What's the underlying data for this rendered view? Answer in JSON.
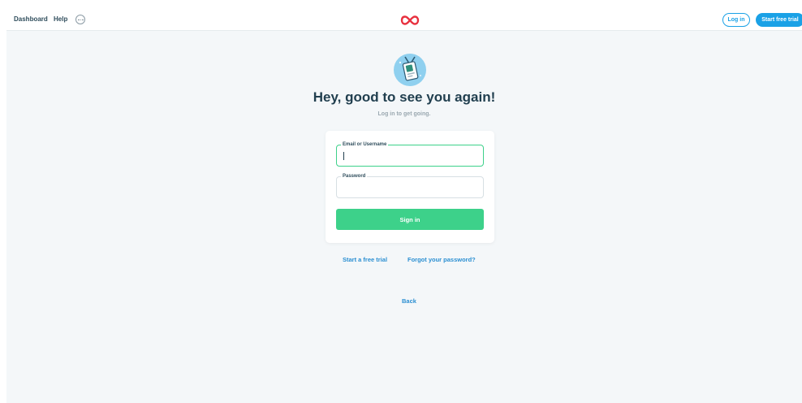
{
  "topbar": {
    "nav": [
      {
        "label": "Dashboard"
      },
      {
        "label": "Help"
      }
    ],
    "login_label": "Log in",
    "trial_label": "Start free trial"
  },
  "hero": {
    "title": "Hey, good to see you again!",
    "subtitle": "Log in to get going."
  },
  "form": {
    "email_label": "Email or Username",
    "email_value": "",
    "password_label": "Password",
    "password_value": "",
    "submit_label": "Sign in"
  },
  "links": {
    "trial": "Start a free trial",
    "forgot": "Forgot your password?",
    "back": "Back"
  },
  "icons": {
    "logo": "infinity-logo-icon",
    "more": "more-options-icon",
    "hero": "id-badge-icon"
  },
  "colors": {
    "accent_blue": "#1aa1e6",
    "accent_green": "#3dd18a",
    "logo_red": "#e8313f",
    "heading": "#213f4f",
    "background": "#f4f7f9"
  }
}
